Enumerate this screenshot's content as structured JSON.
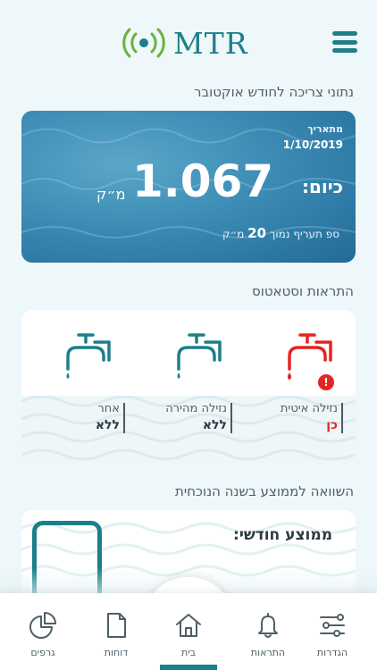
{
  "header": {
    "logo_text": "MTR",
    "menu_icon": "hamburger-menu-icon"
  },
  "consumption": {
    "section_title": "נתוני צריכה לחודש אוקטובר",
    "date_label": "מתאריך",
    "date_value": "1/10/2019",
    "today_label": "כיום:",
    "value": "1.067",
    "unit": "מ״ק",
    "tariff_prefix": "ספ תעריף נמוך",
    "tariff_value": "20",
    "tariff_unit": "מ״ק"
  },
  "alerts": {
    "section_title": "התראות וסטאטוס",
    "items": [
      {
        "label": "נזילה איטית",
        "status": "כן",
        "alert": true,
        "icon": "faucet-dripping-icon",
        "color": "#e52421"
      },
      {
        "label": "נזילה מהירה",
        "status": "ללא",
        "alert": false,
        "icon": "faucet-icon",
        "color": "#1d7f8a"
      },
      {
        "label": "אחר",
        "status": "ללא",
        "alert": false,
        "icon": "faucet-icon",
        "color": "#1d7f8a"
      }
    ],
    "warning_icon": "exclamation-icon"
  },
  "comparison": {
    "section_title": "השוואה לממוצע בשנה הנוכחית",
    "monthly_average_label": "ממוצע חודשי:"
  },
  "bottom_nav": [
    {
      "label": "גרפים",
      "icon": "pie-chart-icon"
    },
    {
      "label": "דוחות",
      "icon": "document-icon"
    },
    {
      "label": "בית",
      "icon": "home-icon",
      "active": true
    },
    {
      "label": "התראות",
      "icon": "bell-icon"
    },
    {
      "label": "הגדרות",
      "icon": "sliders-icon"
    }
  ],
  "colors": {
    "accent": "#1d7f8a",
    "alert": "#e52421",
    "logo_green": "#6db33f"
  }
}
